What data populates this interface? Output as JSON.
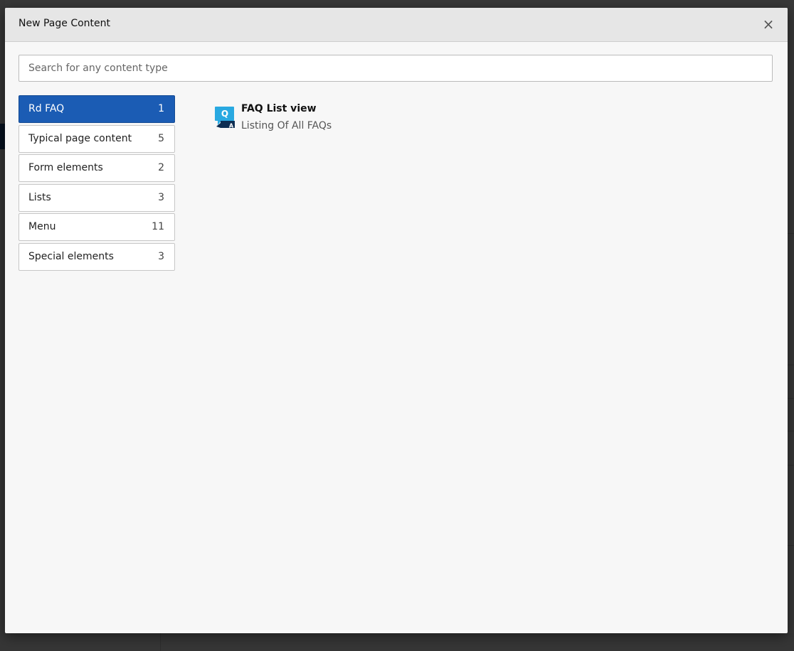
{
  "modal": {
    "title": "New Page Content",
    "close_label": "×"
  },
  "search": {
    "placeholder": "Search for any content type",
    "value": ""
  },
  "categories": [
    {
      "label": "Rd FAQ",
      "count": "1",
      "active": true
    },
    {
      "label": "Typical page content",
      "count": "5",
      "active": false
    },
    {
      "label": "Form elements",
      "count": "2",
      "active": false
    },
    {
      "label": "Lists",
      "count": "3",
      "active": false
    },
    {
      "label": "Menu",
      "count": "11",
      "active": false
    },
    {
      "label": "Special elements",
      "count": "3",
      "active": false
    }
  ],
  "content_items": [
    {
      "title": "FAQ List view",
      "description": "Listing Of All FAQs",
      "icon": "faq-icon",
      "icon_letters": {
        "top": "Q",
        "bottom": "A"
      }
    }
  ],
  "colors": {
    "accent": "#1b5cb4",
    "icon_light": "#29a9e1",
    "icon_dark": "#0d2d52"
  }
}
